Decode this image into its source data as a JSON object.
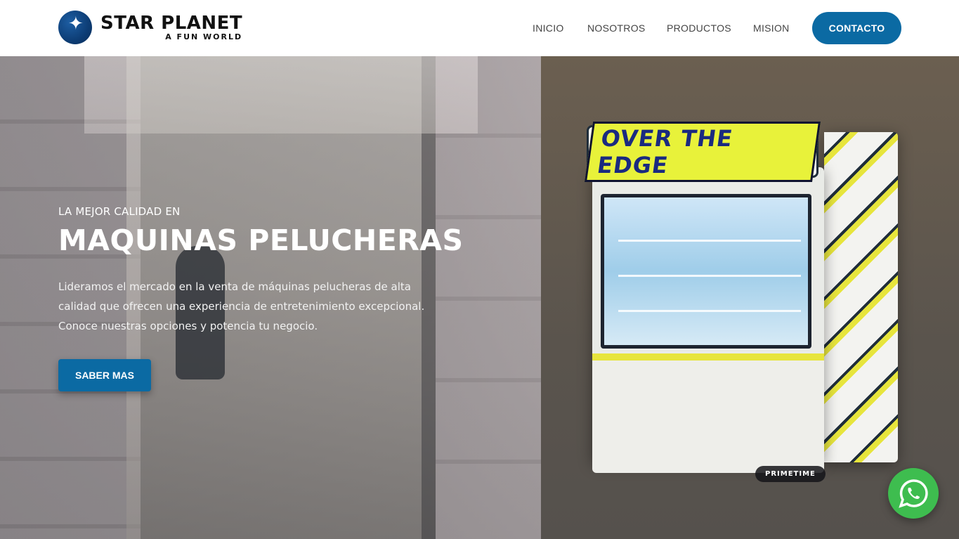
{
  "brand": {
    "name": "STAR PLANET",
    "tagline": "A FUN WORLD",
    "logo_icon": "star-planet-logo"
  },
  "nav": {
    "items": [
      {
        "label": "INICIO"
      },
      {
        "label": "NOSOTROS"
      },
      {
        "label": "PRODUCTOS"
      },
      {
        "label": "MISION"
      }
    ],
    "contact_label": "CONTACTO"
  },
  "hero": {
    "eyebrow": "LA MEJOR CALIDAD EN",
    "headline": "MAQUINAS PELUCHERAS",
    "description": "Lideramos el mercado en la venta de máquinas pelucheras de alta calidad que ofrecen una experiencia de entretenimiento excepcional. Conoce nuestras opciones y potencia tu negocio.",
    "cta_label": "SABER MAS"
  },
  "machine": {
    "marquee_text": "OVER THE EDGE",
    "badge_text": "PRIMETIME"
  },
  "whatsapp": {
    "icon": "whatsapp-icon"
  },
  "colors": {
    "accent": "#0b6aa3",
    "whatsapp": "#3ebd4f",
    "text_dark": "#111111"
  }
}
